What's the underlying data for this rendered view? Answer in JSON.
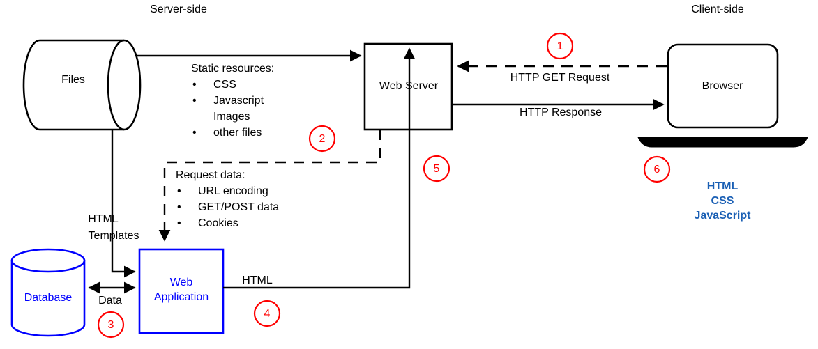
{
  "diagram": {
    "title_left": "Server-side",
    "title_right": "Client-side",
    "nodes": {
      "files": "Files",
      "web_server": "Web Server",
      "browser": "Browser",
      "database": "Database",
      "web_application_line1": "Web",
      "web_application_line2": "Application"
    },
    "edge_labels": {
      "static_resources_heading": "Static resources:",
      "static_resources_items": [
        "CSS",
        "Javascript",
        "Images",
        "other files"
      ],
      "request_data_heading": "Request data:",
      "request_data_items": [
        "URL encoding",
        "GET/POST data",
        "Cookies"
      ],
      "http_get_request": "HTTP GET Request",
      "http_response": "HTTP Response",
      "html_templates_line1": "HTML",
      "html_templates_line2": "Templates",
      "data": "Data",
      "html": "HTML"
    },
    "client_stack": [
      "HTML",
      "CSS",
      "JavaScript"
    ],
    "step_markers": [
      "1",
      "2",
      "3",
      "4",
      "5",
      "6"
    ],
    "colors": {
      "stroke": "#000000",
      "blue": "#0000ff",
      "marker_red": "#ff0000",
      "client_stack_blue": "#1a5fb4",
      "background": "#ffffff"
    }
  }
}
